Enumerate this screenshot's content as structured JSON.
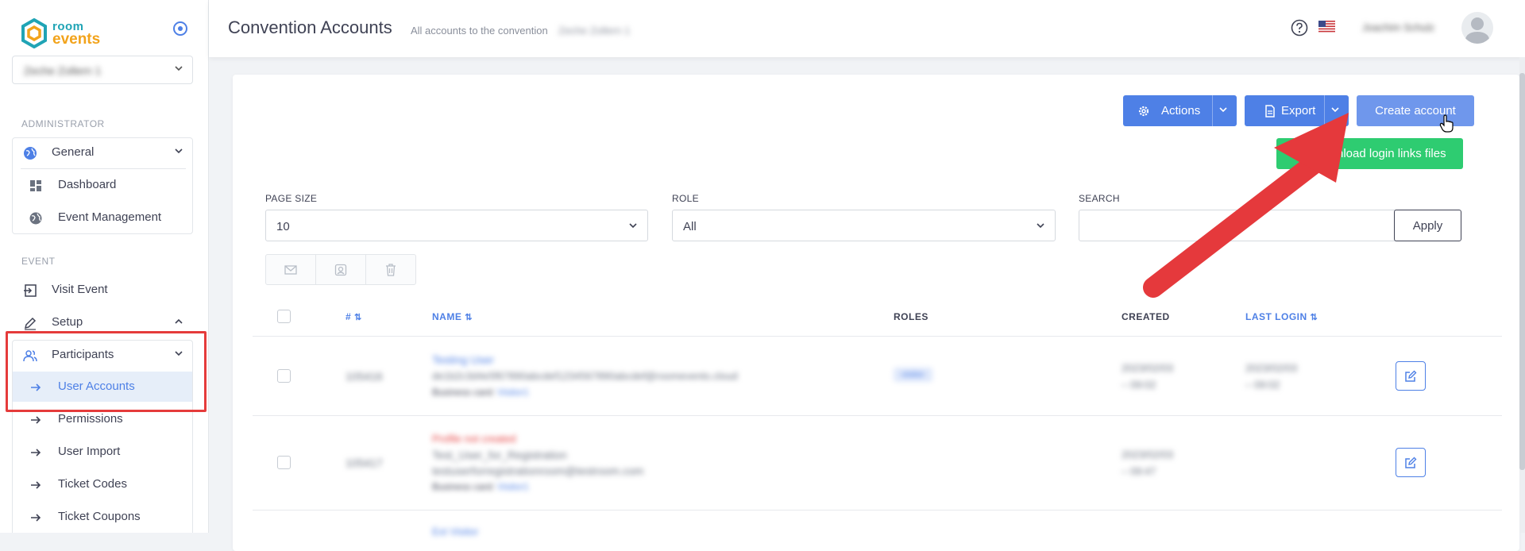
{
  "brand": {
    "room": "room",
    "events": "events"
  },
  "sidebar": {
    "event_select_value": "Zeche Zollern 1",
    "section_admin": "ADMINISTRATOR",
    "section_event": "EVENT",
    "items": [
      {
        "label": "General"
      },
      {
        "label": "Dashboard"
      },
      {
        "label": "Event Management"
      },
      {
        "label": "Visit Event"
      },
      {
        "label": "Setup"
      },
      {
        "label": "Participants"
      },
      {
        "label": "User Accounts"
      },
      {
        "label": "Permissions"
      },
      {
        "label": "User Import"
      },
      {
        "label": "Ticket Codes"
      },
      {
        "label": "Ticket Coupons"
      }
    ]
  },
  "header": {
    "title": "Convention Accounts",
    "subtitle": "All accounts to the convention",
    "subtitle_name": "Zeche Zollern 1",
    "user_name": "Joachim Schulz"
  },
  "toolbar": {
    "actions_label": "Actions",
    "export_label": "Export",
    "create_label": "Create account",
    "download_label": "Download login links files"
  },
  "filters": {
    "page_size_label": "PAGE SIZE",
    "page_size_value": "10",
    "role_label": "ROLE",
    "role_value": "All",
    "search_label": "SEARCH",
    "search_value": "",
    "apply_label": "Apply"
  },
  "table": {
    "headers": {
      "id": "#",
      "name": "NAME",
      "roles": "ROLES",
      "created": "CREATED",
      "last_login": "LAST LOGIN"
    },
    "rows": [
      {
        "id": "105416",
        "name": "Testing User",
        "email": "de1b2c3d4e5f67890abcdef1234567890abcdef@roomevents.cloud",
        "card_label": "Business card:",
        "card_value": "Visitor1",
        "status": "",
        "role": "visitor",
        "created_date": "2023/02/03",
        "created_time": "– 09:02",
        "login_date": "2023/02/03",
        "login_time": "– 09:02"
      },
      {
        "id": "105417",
        "name": "Test_User_for_Registration",
        "email": "testuserforregistrationroom@testroom.com",
        "card_label": "Business card:",
        "card_value": "Visitor1",
        "status": "Profile not created",
        "role": "",
        "created_date": "2023/02/03",
        "created_time": "– 09:47",
        "login_date": "",
        "login_time": ""
      }
    ],
    "third_row_name": "Ext Visitor"
  },
  "colors": {
    "primary": "#4e80e6",
    "success": "#2ecc71",
    "annotation_red": "#e53b3b"
  }
}
